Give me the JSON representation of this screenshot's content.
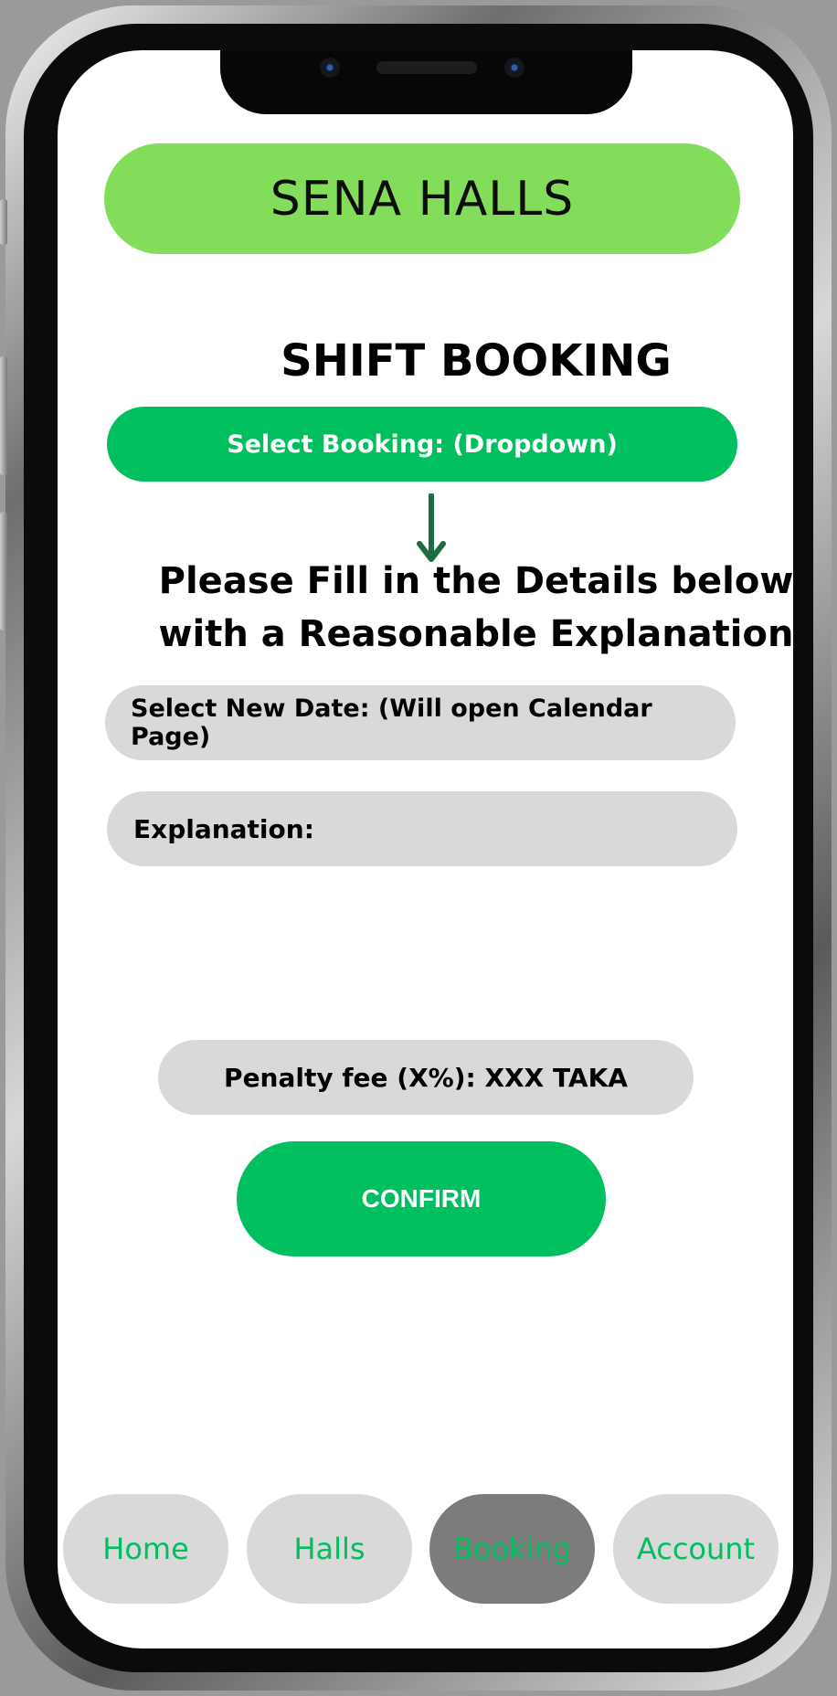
{
  "app": {
    "title": "SENA HALLS"
  },
  "page": {
    "title": "SHIFT BOOKING"
  },
  "booking_select": {
    "label": "Select Booking: (Dropdown)"
  },
  "instructions": {
    "line1": "Please Fill in the Details below",
    "line2": "with a Reasonable Explanation"
  },
  "form": {
    "date_label": "Select New Date: (Will open Calendar Page)",
    "explanation_label": "Explanation:"
  },
  "penalty": {
    "text": "Penalty fee (X%): XXX TAKA"
  },
  "actions": {
    "confirm_label": "CONFIRM"
  },
  "nav": {
    "items": [
      {
        "label": "Home"
      },
      {
        "label": "Halls"
      },
      {
        "label": "Booking"
      },
      {
        "label": "Account"
      }
    ],
    "active": "Booking"
  },
  "colors": {
    "header_bg": "#83dc5a",
    "accent_green": "#00bf5f",
    "arrow": "#1c6b45",
    "field_bg": "#d9d9d9",
    "nav_active_bg": "#7c7c7c"
  },
  "icons": {
    "arrow": "arrow-down-icon"
  }
}
